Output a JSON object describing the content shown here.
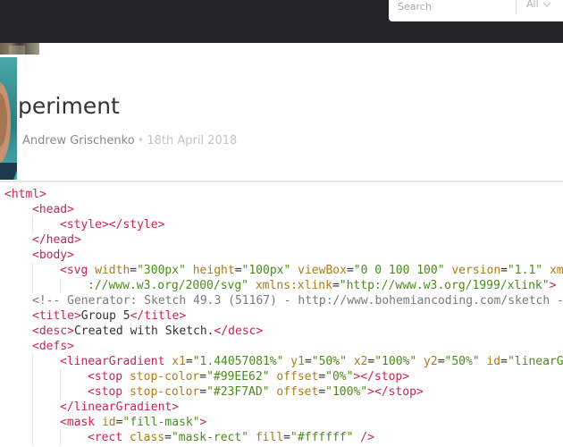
{
  "search": {
    "placeholder": "Search",
    "filter_label": "All"
  },
  "article": {
    "title_visible": "periment",
    "author": "Andrew Grischenko",
    "separator": "•",
    "date": "18th April 2018"
  },
  "icons": {
    "filter": "chevron-down-icon"
  },
  "colors": {
    "topbar": "#222426",
    "tag_punct": "#c8264b",
    "attr_name": "#ad7b1b",
    "attr_value": "#4a8c1b",
    "comment": "#7a7a7a"
  },
  "code_lines": [
    {
      "indent": 0,
      "tokens": [
        [
          "p",
          "<"
        ],
        [
          "p",
          "html"
        ],
        [
          "p",
          ">"
        ]
      ]
    },
    {
      "indent": 1,
      "tokens": [
        [
          "p",
          "<"
        ],
        [
          "p",
          "head"
        ],
        [
          "p",
          ">"
        ]
      ]
    },
    {
      "indent": 2,
      "tokens": [
        [
          "p",
          "<"
        ],
        [
          "p",
          "style"
        ],
        [
          "p",
          "></"
        ],
        [
          "p",
          "style"
        ],
        [
          "p",
          ">"
        ]
      ]
    },
    {
      "indent": 1,
      "tokens": [
        [
          "p",
          "</"
        ],
        [
          "p",
          "head"
        ],
        [
          "p",
          ">"
        ]
      ]
    },
    {
      "indent": 1,
      "tokens": [
        [
          "p",
          "<"
        ],
        [
          "p",
          "body"
        ],
        [
          "p",
          ">"
        ]
      ]
    },
    {
      "indent": 2,
      "tokens": [
        [
          "p",
          "<"
        ],
        [
          "p",
          "svg"
        ],
        [
          "x",
          " "
        ],
        [
          "a",
          "width"
        ],
        [
          "x",
          "="
        ],
        [
          "s",
          "\"300px\""
        ],
        [
          "x",
          " "
        ],
        [
          "a",
          "height"
        ],
        [
          "x",
          "="
        ],
        [
          "s",
          "\"100px\""
        ],
        [
          "x",
          " "
        ],
        [
          "a",
          "viewBox"
        ],
        [
          "x",
          "="
        ],
        [
          "s",
          "\"0 0 100 100\""
        ],
        [
          "x",
          " "
        ],
        [
          "a",
          "version"
        ],
        [
          "x",
          "="
        ],
        [
          "s",
          "\"1.1\""
        ],
        [
          "x",
          " "
        ],
        [
          "a",
          "xm"
        ]
      ]
    },
    {
      "indent": 3,
      "tokens": [
        [
          "s",
          "://www.w3.org/2000/svg\""
        ],
        [
          "x",
          " "
        ],
        [
          "a",
          "xmlns:xlink"
        ],
        [
          "x",
          "="
        ],
        [
          "s",
          "\"http://www.w3.org/1999/xlink\""
        ],
        [
          "p",
          ">"
        ]
      ]
    },
    {
      "indent": 1,
      "tokens": [
        [
          "c",
          "<!-- Generator: Sketch 49.3 (51167) - http://www.bohemiancoding.com/sketch -"
        ]
      ]
    },
    {
      "indent": 1,
      "tokens": [
        [
          "p",
          "<"
        ],
        [
          "p",
          "title"
        ],
        [
          "p",
          ">"
        ],
        [
          "x",
          "Group 5"
        ],
        [
          "p",
          "</"
        ],
        [
          "p",
          "title"
        ],
        [
          "p",
          ">"
        ]
      ]
    },
    {
      "indent": 1,
      "tokens": [
        [
          "p",
          "<"
        ],
        [
          "p",
          "desc"
        ],
        [
          "p",
          ">"
        ],
        [
          "x",
          "Created with Sketch."
        ],
        [
          "p",
          "</"
        ],
        [
          "p",
          "desc"
        ],
        [
          "p",
          ">"
        ]
      ]
    },
    {
      "indent": 1,
      "tokens": [
        [
          "p",
          "<"
        ],
        [
          "p",
          "defs"
        ],
        [
          "p",
          ">"
        ]
      ]
    },
    {
      "indent": 2,
      "tokens": [
        [
          "p",
          "<"
        ],
        [
          "p",
          "linearGradient"
        ],
        [
          "x",
          " "
        ],
        [
          "a",
          "x1"
        ],
        [
          "x",
          "="
        ],
        [
          "s",
          "\"1.44057081%\""
        ],
        [
          "x",
          " "
        ],
        [
          "a",
          "y1"
        ],
        [
          "x",
          "="
        ],
        [
          "s",
          "\"50%\""
        ],
        [
          "x",
          " "
        ],
        [
          "a",
          "x2"
        ],
        [
          "x",
          "="
        ],
        [
          "s",
          "\"100%\""
        ],
        [
          "x",
          " "
        ],
        [
          "a",
          "y2"
        ],
        [
          "x",
          "="
        ],
        [
          "s",
          "\"50%\""
        ],
        [
          "x",
          " "
        ],
        [
          "a",
          "id"
        ],
        [
          "x",
          "="
        ],
        [
          "s",
          "\"linearG"
        ]
      ]
    },
    {
      "indent": 3,
      "tokens": [
        [
          "p",
          "<"
        ],
        [
          "p",
          "stop"
        ],
        [
          "x",
          " "
        ],
        [
          "a",
          "stop-color"
        ],
        [
          "x",
          "="
        ],
        [
          "s",
          "\"#99EE62\""
        ],
        [
          "x",
          " "
        ],
        [
          "a",
          "offset"
        ],
        [
          "x",
          "="
        ],
        [
          "s",
          "\"0%\""
        ],
        [
          "p",
          "></"
        ],
        [
          "p",
          "stop"
        ],
        [
          "p",
          ">"
        ]
      ]
    },
    {
      "indent": 3,
      "tokens": [
        [
          "p",
          "<"
        ],
        [
          "p",
          "stop"
        ],
        [
          "x",
          " "
        ],
        [
          "a",
          "stop-color"
        ],
        [
          "x",
          "="
        ],
        [
          "s",
          "\"#23F7AD\""
        ],
        [
          "x",
          " "
        ],
        [
          "a",
          "offset"
        ],
        [
          "x",
          "="
        ],
        [
          "s",
          "\"100%\""
        ],
        [
          "p",
          "></"
        ],
        [
          "p",
          "stop"
        ],
        [
          "p",
          ">"
        ]
      ]
    },
    {
      "indent": 2,
      "tokens": [
        [
          "p",
          "</"
        ],
        [
          "p",
          "linearGradient"
        ],
        [
          "p",
          ">"
        ]
      ]
    },
    {
      "indent": 2,
      "tokens": [
        [
          "p",
          "<"
        ],
        [
          "p",
          "mask"
        ],
        [
          "x",
          " "
        ],
        [
          "a",
          "id"
        ],
        [
          "x",
          "="
        ],
        [
          "s",
          "\"fill-mask\""
        ],
        [
          "p",
          ">"
        ]
      ]
    },
    {
      "indent": 3,
      "tokens": [
        [
          "p",
          "<"
        ],
        [
          "p",
          "rect"
        ],
        [
          "x",
          " "
        ],
        [
          "a",
          "class"
        ],
        [
          "x",
          "="
        ],
        [
          "s",
          "\"mask-rect\""
        ],
        [
          "x",
          " "
        ],
        [
          "a",
          "fill"
        ],
        [
          "x",
          "="
        ],
        [
          "s",
          "\"#ffffff\""
        ],
        [
          "x",
          " "
        ],
        [
          "p",
          "/>"
        ]
      ]
    }
  ]
}
